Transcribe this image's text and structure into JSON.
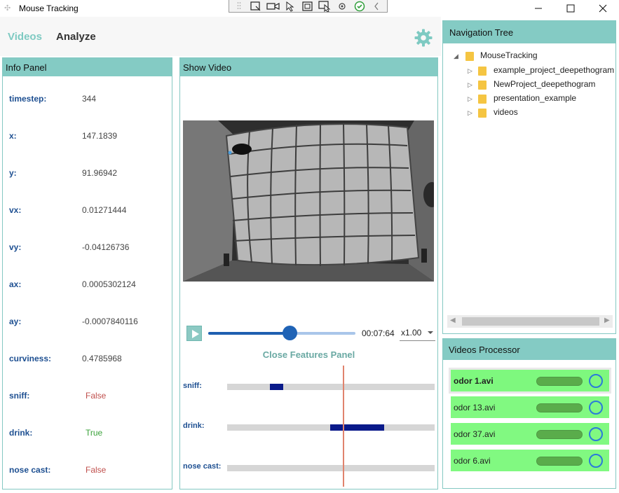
{
  "window": {
    "title": "Mouse Tracking"
  },
  "top_nav": {
    "tabs": [
      "Videos",
      "Analyze"
    ],
    "active_tab": "Videos",
    "accent": "#7ecac2"
  },
  "info_panel": {
    "title": "Info Panel",
    "rows": [
      {
        "label": "timestep:",
        "value": "344"
      },
      {
        "label": "x:",
        "value": "147.1839"
      },
      {
        "label": "y:",
        "value": "91.96942"
      },
      {
        "label": "vx:",
        "value": "0.01271444"
      },
      {
        "label": "vy:",
        "value": "-0.04126736"
      },
      {
        "label": "ax:",
        "value": "0.0005302124"
      },
      {
        "label": "ay:",
        "value": "-0.0007840116"
      },
      {
        "label": "curviness:",
        "value": "0.4785968"
      },
      {
        "label": "sniff:",
        "value": "False"
      },
      {
        "label": "drink:",
        "value": "True"
      },
      {
        "label": "nose cast:",
        "value": "False"
      }
    ]
  },
  "video_panel": {
    "title": "Show Video",
    "time": "00:07:64",
    "speed": "x1.00",
    "progress": 0.56,
    "close_features_label": "Close Features Panel",
    "features": [
      {
        "label": "sniff:",
        "segments": [
          [
            0.21,
            0.27
          ]
        ]
      },
      {
        "label": "drink:",
        "segments": [
          [
            0.5,
            0.76
          ]
        ]
      },
      {
        "label": "nose cast:",
        "segments": []
      }
    ]
  },
  "nav_tree": {
    "title": "Navigation Tree",
    "root": "MouseTracking",
    "children": [
      "example_project_deepethogram",
      "NewProject_deepethogram",
      "presentation_example",
      "videos"
    ]
  },
  "videos_processor": {
    "title": "Videos Processor",
    "items": [
      {
        "name": "odor 1.avi",
        "selected": true
      },
      {
        "name": "odor 13.avi",
        "selected": false
      },
      {
        "name": "odor 37.avi",
        "selected": false
      },
      {
        "name": "odor 6.avi",
        "selected": false
      }
    ]
  }
}
